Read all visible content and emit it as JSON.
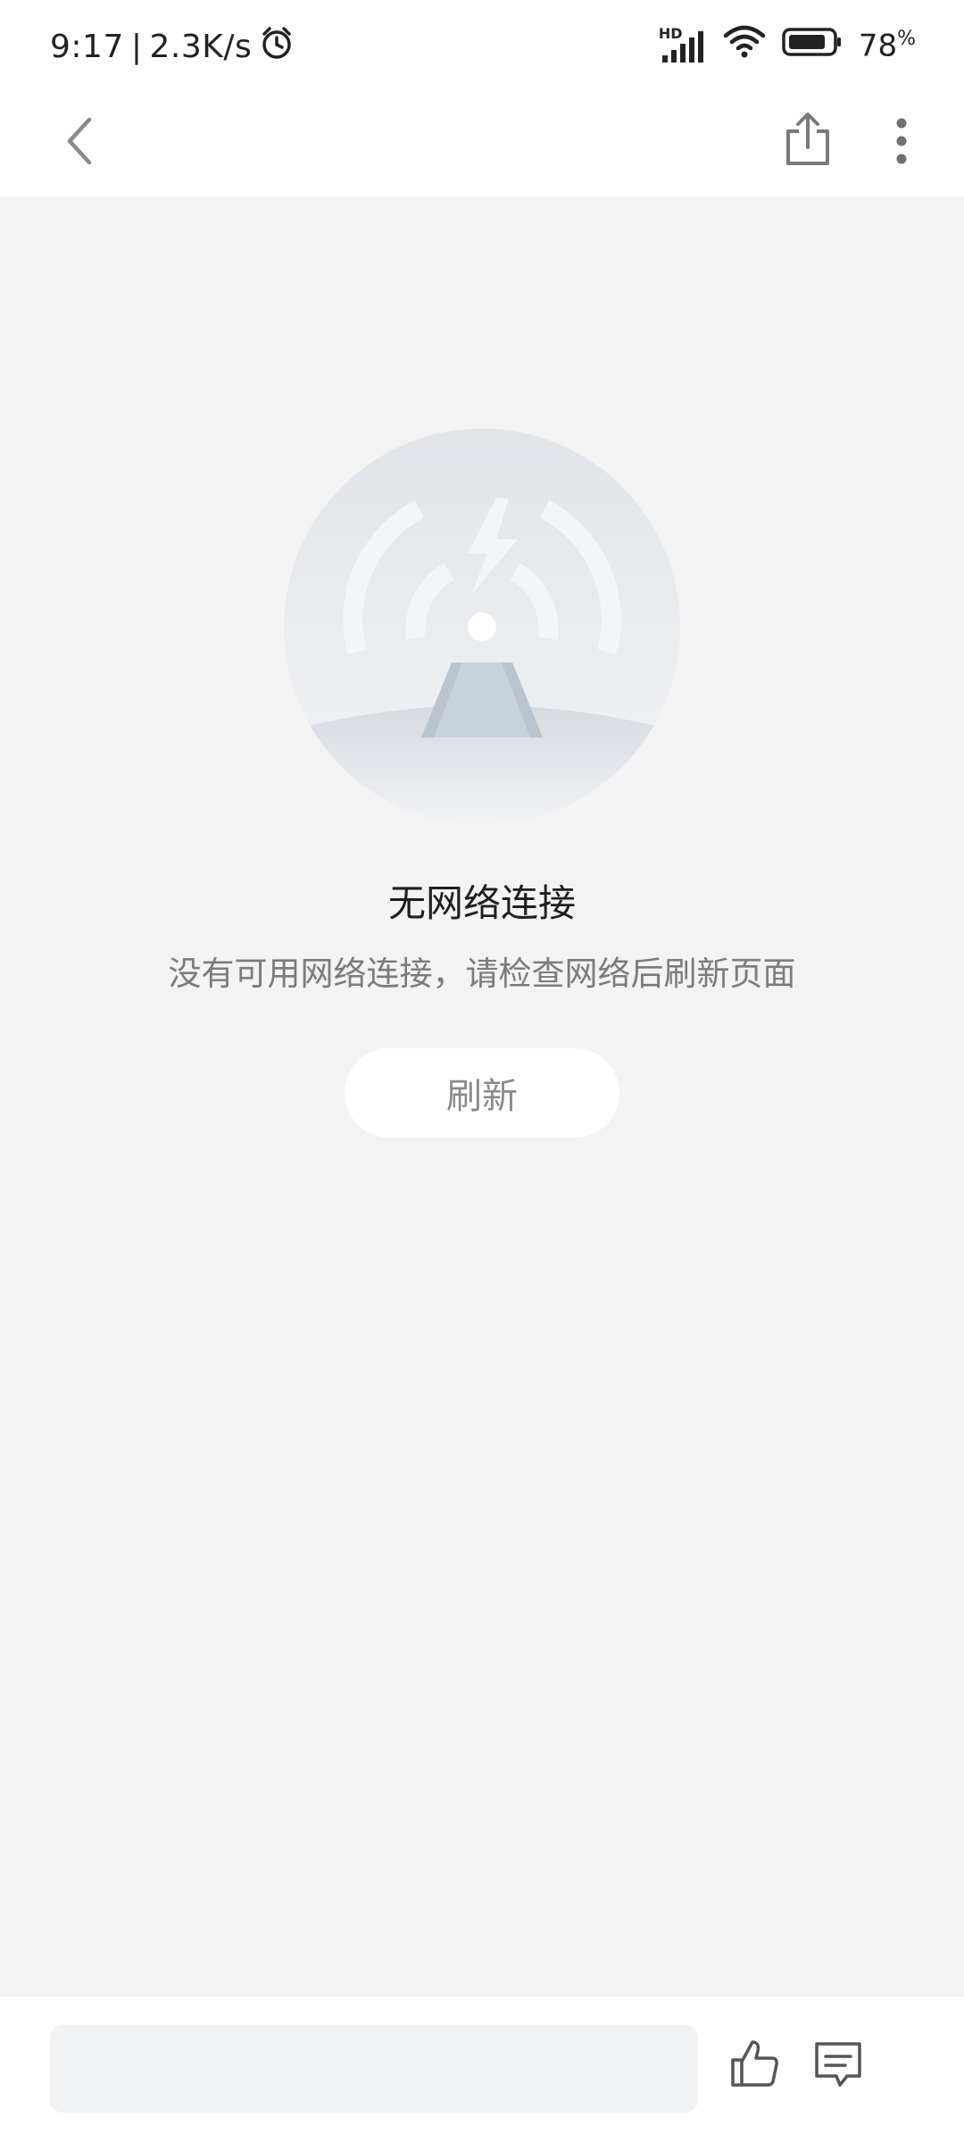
{
  "status_bar": {
    "time": "9:17",
    "separator": "|",
    "net_speed": "2.3K/s",
    "network_badge": "HD",
    "battery_level": "78",
    "battery_unit": "%"
  },
  "nav": {
    "back_icon": "chevron-left-icon",
    "share_icon": "share-icon",
    "more_icon": "more-vertical-icon"
  },
  "empty_state": {
    "title": "无网络连接",
    "message": "没有可用网络连接，请检查网络后刷新页面",
    "refresh_label": "刷新"
  },
  "bottom_bar": {
    "comment_placeholder": "",
    "like_icon": "thumbs-up-icon",
    "comment_icon": "comment-icon"
  },
  "colors": {
    "background": "#f3f3f3",
    "surface": "#ffffff",
    "text_primary": "#1f1f1f",
    "text_secondary": "#7b7b7b"
  }
}
